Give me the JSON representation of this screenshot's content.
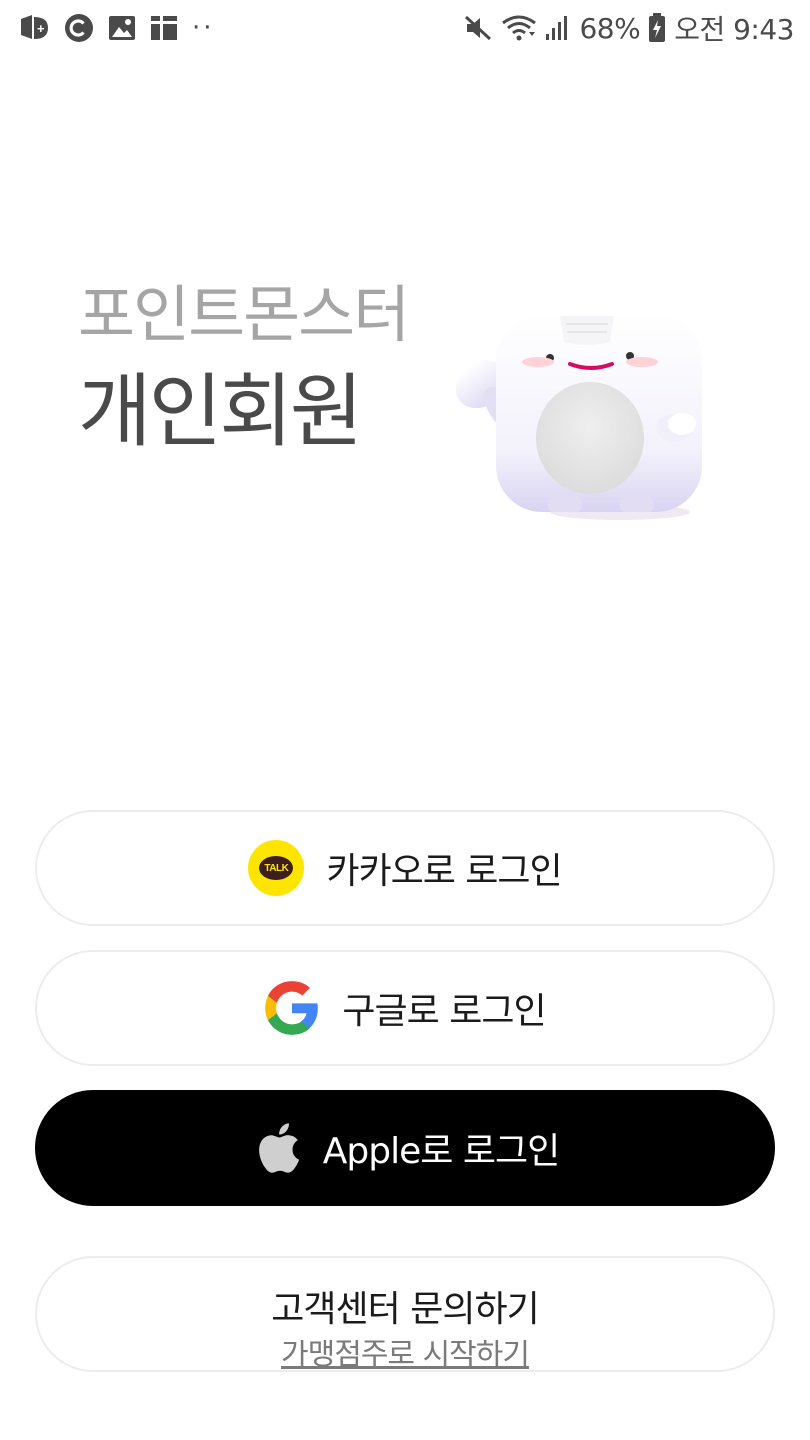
{
  "status_bar": {
    "left_icons": [
      "u-plus-icon",
      "c-badge-icon",
      "image-icon",
      "calendar-icon",
      "more-dots-icon"
    ],
    "more_dots": "··",
    "right_icons": [
      "mute-icon",
      "wifi-icon",
      "signal-icon",
      "battery-icon"
    ],
    "battery_percent": "68%",
    "time": "오전 9:43"
  },
  "hero": {
    "brand": "포인트몬스터",
    "title": "개인회원",
    "mascot_icon": "mascot-illustration"
  },
  "buttons": {
    "kakao_label": "카카오로 로그인",
    "kakao_icon_text": "TALK",
    "google_label": "구글로 로그인",
    "apple_label": "Apple로 로그인",
    "support_label": "고객센터 문의하기"
  },
  "footer": {
    "owner_link": "가맹점주로 시작하기"
  },
  "colors": {
    "kakao_yellow": "#FEE500",
    "apple_black": "#000000",
    "border_gray": "#ECECEC",
    "brand_gray": "#A5A5A5",
    "title_dark": "#4A4A4A"
  }
}
